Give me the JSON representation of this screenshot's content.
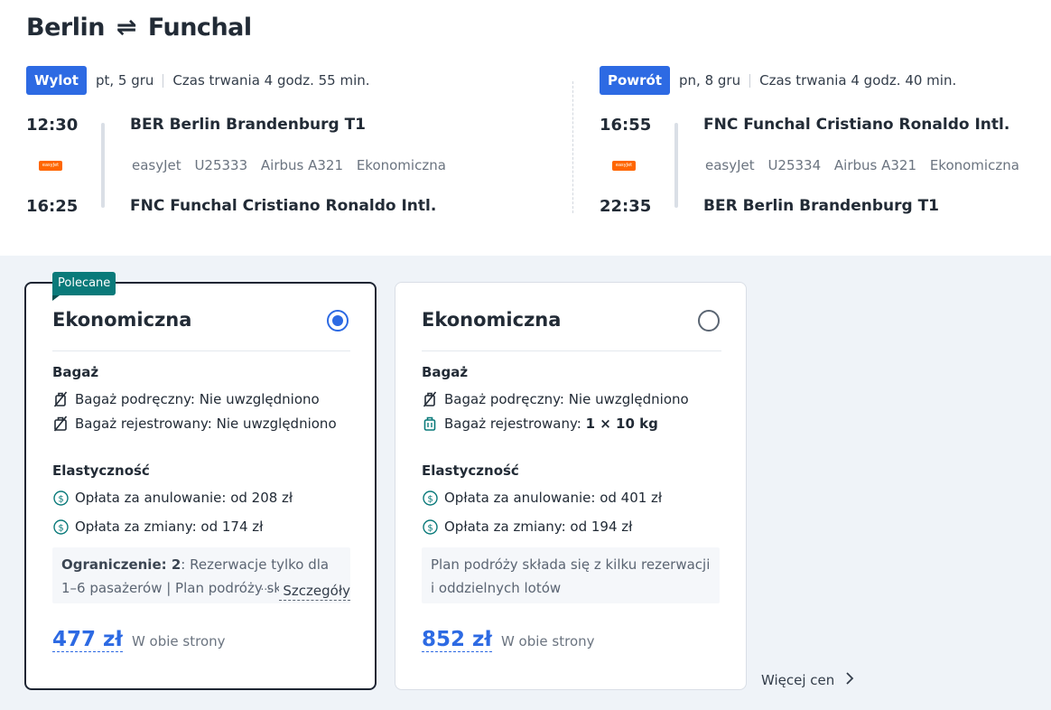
{
  "header": {
    "origin": "Berlin",
    "swap_symbol": "⇌",
    "destination": "Funchal"
  },
  "outbound": {
    "badge": "Wylot",
    "date": "pt, 5 gru",
    "duration": "Czas trwania 4 godz. 55 min.",
    "dep_time": "12:30",
    "arr_time": "16:25",
    "dep_airport": "BER Berlin Brandenburg T1",
    "arr_airport": "FNC Funchal Cristiano Ronaldo Intl.",
    "airline": "easyJet",
    "flight_no": "U25333",
    "aircraft": "Airbus A321",
    "cabin": "Ekonomiczna",
    "logo_text": "easyJet"
  },
  "inbound": {
    "badge": "Powrót",
    "date": "pn, 8 gru",
    "duration": "Czas trwania 4 godz. 40 min.",
    "dep_time": "16:55",
    "arr_time": "22:35",
    "dep_airport": "FNC Funchal Cristiano Ronaldo Intl.",
    "arr_airport": "BER Berlin Brandenburg T1",
    "airline": "easyJet",
    "flight_no": "U25334",
    "aircraft": "Airbus A321",
    "cabin": "Ekonomiczna",
    "logo_text": "easyJet"
  },
  "fares": [
    {
      "tag": "Polecane",
      "name": "Ekonomiczna",
      "selected": true,
      "baggage_title": "Bagaż",
      "carry_on": "Bagaż podręczny: Nie uwzględniono",
      "checked_label": "Bagaż rejestrowany:",
      "checked_value": "Nie uwzględniono",
      "flex_title": "Elastyczność",
      "cancel_fee": "Opłata za anulowanie: od 208 zł",
      "change_fee": "Opłata za zmiany: od 174 zł",
      "note_label": "Ograniczenie: 2",
      "note_text": ": Rezerwacje tylko dla 1–6 pasażerów | Plan podróży skła",
      "note_ellipsis": "...",
      "note_more": "Szczegóły",
      "price": "477 zł",
      "price_label": "W obie strony"
    },
    {
      "name": "Ekonomiczna",
      "selected": false,
      "baggage_title": "Bagaż",
      "carry_on": "Bagaż podręczny: Nie uwzględniono",
      "checked_label": "Bagaż rejestrowany:",
      "checked_value": "1 × 10 kg",
      "flex_title": "Elastyczność",
      "cancel_fee": "Opłata za anulowanie: od 401 zł",
      "change_fee": "Opłata za zmiany: od 194 zł",
      "note_text": "Plan podróży składa się z kilku rezerwacji i oddzielnych lotów",
      "price": "852 zł",
      "price_label": "W obie strony"
    }
  ],
  "more_prices": "Więcej cen",
  "icons": {
    "no_bag": "no-bag-icon",
    "checked_bag": "suitcase-icon",
    "fee": "dollar-circle-icon",
    "chevron": "chevron-right-icon"
  },
  "colors": {
    "accent": "#2d6ae3",
    "tag": "#0a7a7a",
    "airline": "#ff6600"
  }
}
